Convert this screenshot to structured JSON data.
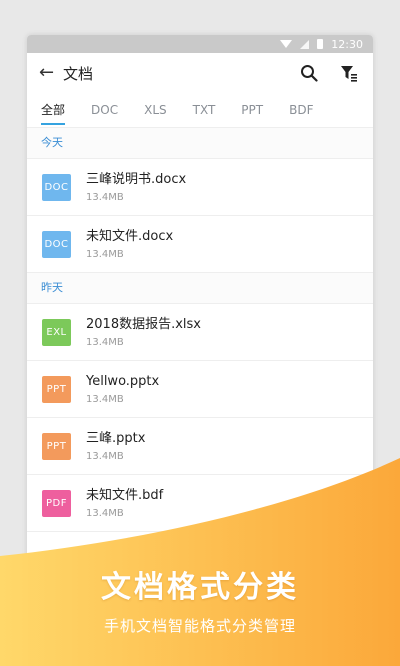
{
  "statusbar": {
    "time": "12:30"
  },
  "toolbar": {
    "back_glyph": "←",
    "title": "文档"
  },
  "tabs": [
    {
      "label": "全部",
      "active": true
    },
    {
      "label": "DOC"
    },
    {
      "label": "XLS"
    },
    {
      "label": "TXT"
    },
    {
      "label": "PPT"
    },
    {
      "label": "BDF"
    }
  ],
  "sections": [
    {
      "label": "今天",
      "files": [
        {
          "type": "DOC",
          "color": "#6fb7ee",
          "name": "三峰说明书.docx",
          "size": "13.4MB"
        },
        {
          "type": "DOC",
          "color": "#6fb7ee",
          "name": "未知文件.docx",
          "size": "13.4MB"
        }
      ]
    },
    {
      "label": "昨天",
      "files": [
        {
          "type": "EXL",
          "color": "#7cc95a",
          "name": "2018数据报告.xlsx",
          "size": "13.4MB"
        },
        {
          "type": "PPT",
          "color": "#f39a5c",
          "name": "Yellwo.pptx",
          "size": "13.4MB"
        },
        {
          "type": "PPT",
          "color": "#f39a5c",
          "name": "三峰.pptx",
          "size": "13.4MB"
        },
        {
          "type": "PDF",
          "color": "#ee5f9e",
          "name": "未知文件.bdf",
          "size": "13.4MB"
        }
      ]
    }
  ],
  "promo": {
    "headline": "文档格式分类",
    "subline": "手机文档智能格式分类管理",
    "gradient_start": "#ffd86a",
    "gradient_end": "#fba83a"
  }
}
